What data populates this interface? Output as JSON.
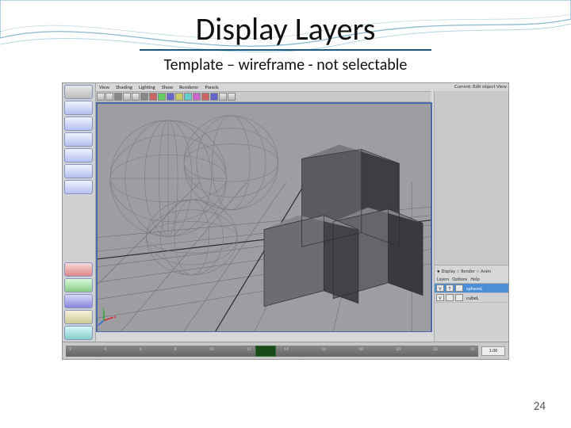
{
  "slide": {
    "title": "Display Layers",
    "subtitle": "Template – wireframe - not selectable",
    "page_number": "24"
  },
  "app": {
    "menu": {
      "view": "View",
      "shading": "Shading",
      "lighting": "Lighting",
      "show": "Show",
      "renderer": "Renderer",
      "panels": "Panels"
    },
    "camera_label": "Current: Edit object View",
    "layer_tabs": {
      "display": "Display",
      "render": "Render",
      "anim": "Anim"
    },
    "layer_menu": {
      "layers": "Layers",
      "options": "Options",
      "help": "Help"
    },
    "layers": [
      {
        "v": "V",
        "t": "T",
        "name": "sphereL"
      },
      {
        "v": "V",
        "t": "",
        "name": "cubeL"
      }
    ],
    "timeline": {
      "ticks": [
        "2",
        "4",
        "6",
        "8",
        "10",
        "12",
        "14",
        "16",
        "18",
        "20",
        "22",
        "24"
      ],
      "frame": "1.00"
    }
  }
}
